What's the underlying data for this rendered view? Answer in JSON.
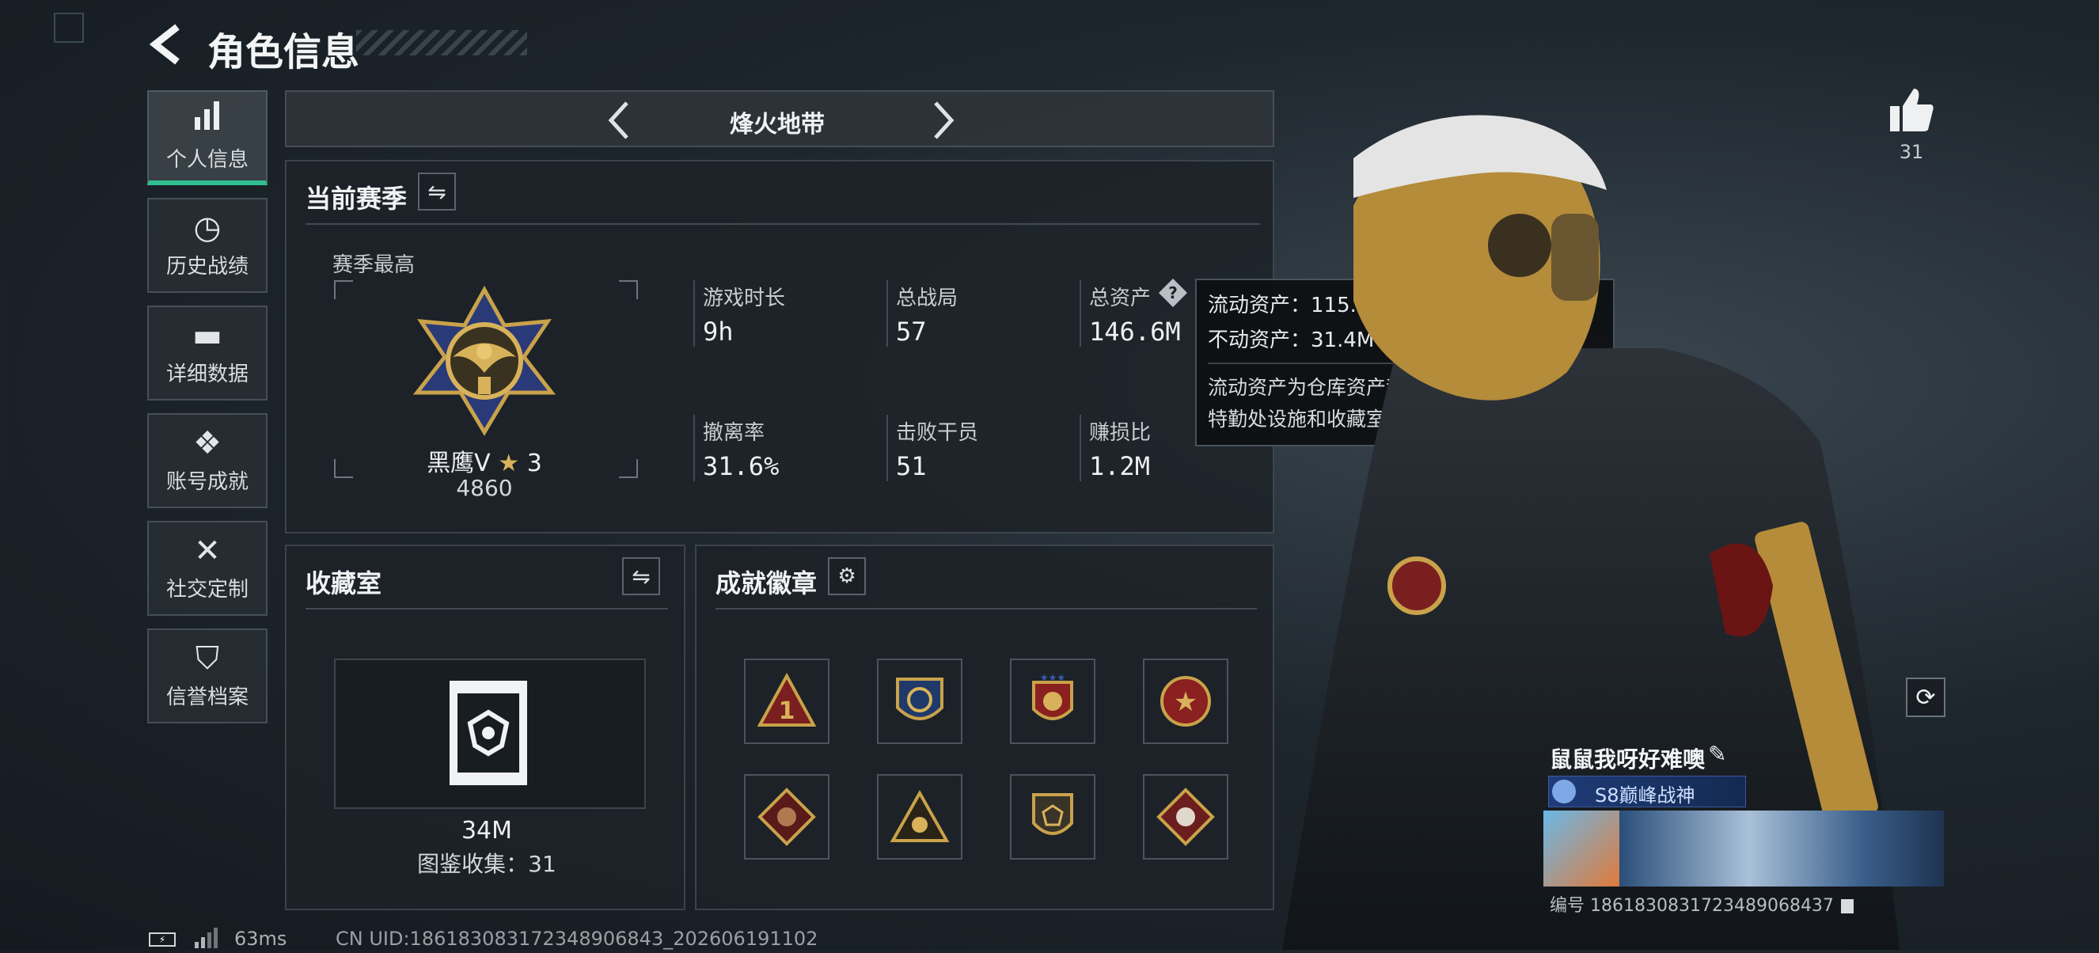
{
  "header": {
    "title": "角色信息"
  },
  "sidebar": {
    "items": [
      {
        "label": "个人信息",
        "icon": "bar-chart-icon",
        "active": true
      },
      {
        "label": "历史战绩",
        "icon": "history-icon"
      },
      {
        "label": "详细数据",
        "icon": "folder-icon"
      },
      {
        "label": "账号成就",
        "icon": "achievement-icon"
      },
      {
        "label": "社交定制",
        "icon": "tools-icon"
      },
      {
        "label": "信誉档案",
        "icon": "shield-icon"
      }
    ]
  },
  "mode_selector": {
    "label": "烽火地带"
  },
  "season": {
    "title": "当前赛季",
    "best_label": "赛季最高",
    "rank_name": "黑鹰V",
    "rank_stars": "3",
    "rank_score": "4860",
    "stats": [
      {
        "label": "游戏时长",
        "value": "9h"
      },
      {
        "label": "总战局",
        "value": "57"
      },
      {
        "label": "总资产",
        "value": "146.6M"
      },
      {
        "label": "撤离率",
        "value": "31.6%"
      },
      {
        "label": "击败干员",
        "value": "51"
      },
      {
        "label": "赚损比",
        "value": "1.2M"
      }
    ]
  },
  "tooltip": {
    "liquid": "流动资产：115.3M",
    "fixed": "不动资产：31.4M",
    "desc": "流动资产为仓库资产和哈夫币，不动资产为特勤处设施和收藏室设施"
  },
  "collection": {
    "title": "收藏室",
    "value": "34M",
    "catalog": "图鉴收集：31"
  },
  "achievements": {
    "title": "成就徽章",
    "badges": [
      "badge-1-icon",
      "badge-2-icon",
      "badge-3-icon",
      "badge-4-icon",
      "badge-5-icon",
      "badge-6-icon",
      "badge-7-icon",
      "badge-8-icon"
    ]
  },
  "like": {
    "count": "31"
  },
  "profile": {
    "name": "鼠鼠我呀好难噢",
    "title_badge": "S8巅峰战神",
    "id_text": "编号 1861830831723489068437"
  },
  "footer": {
    "ping": "63ms",
    "uid": "CN UID:18618308317234890684­3_202606191102"
  },
  "colors": {
    "accent": "#2fbf8f",
    "gold": "#c9a24a",
    "panel": "#1c2228"
  }
}
